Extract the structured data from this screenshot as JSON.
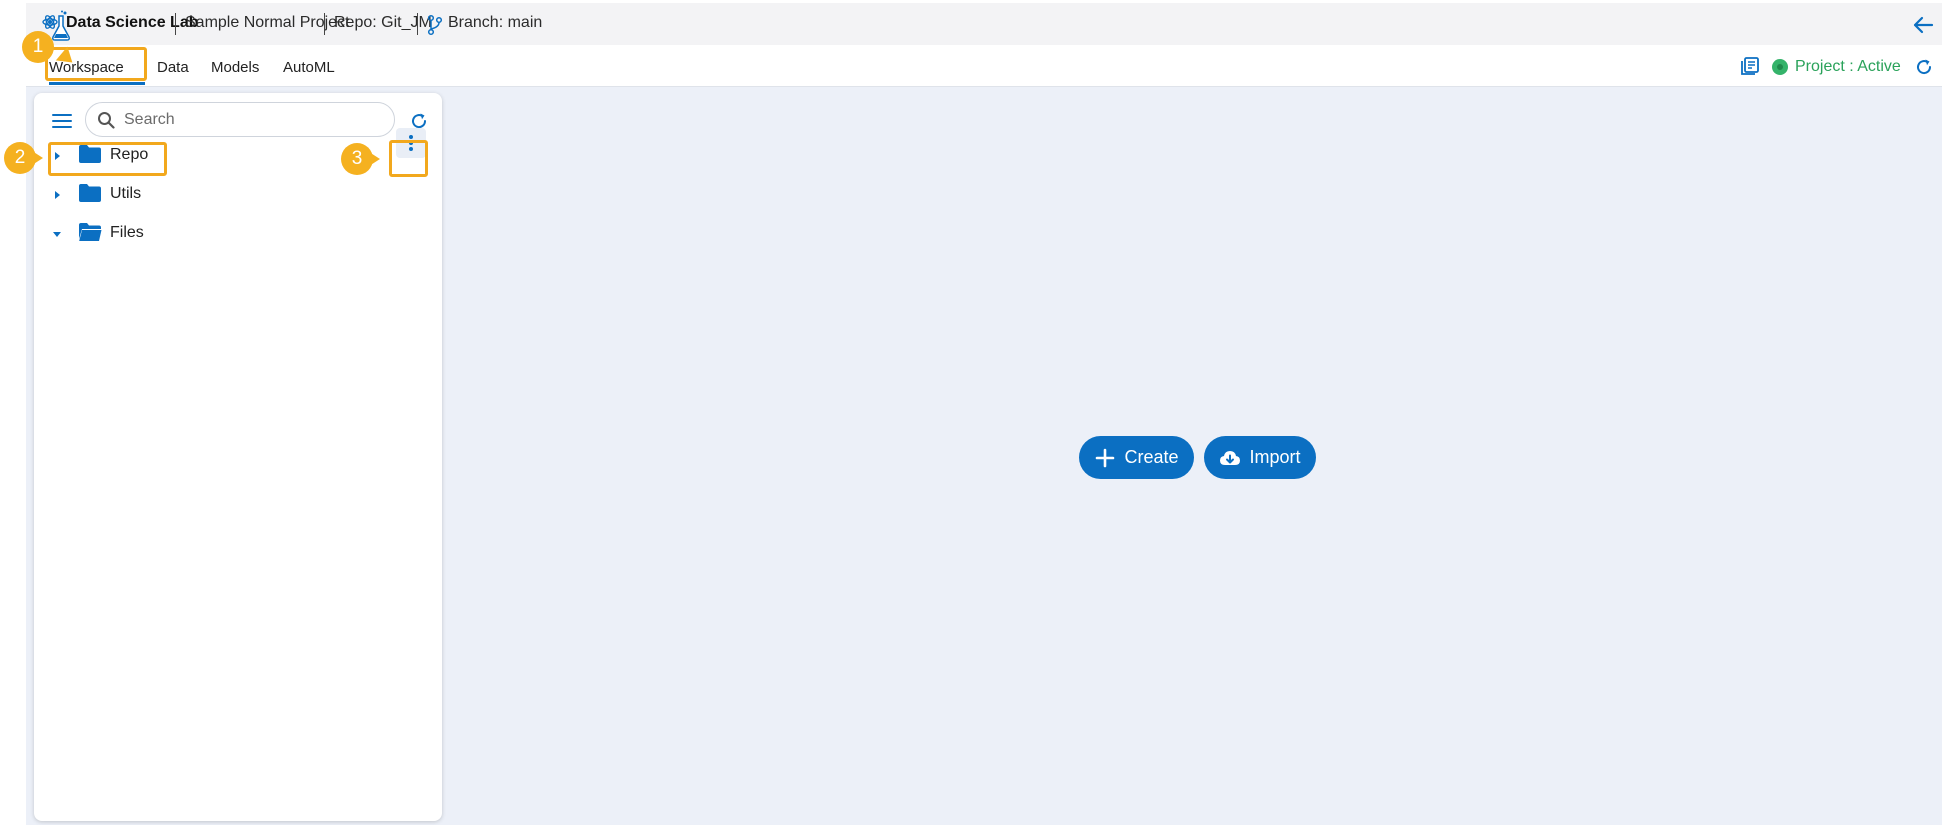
{
  "header": {
    "app_name": "Data Science Lab",
    "project_name": "Sample Normal Project",
    "repo": "Repo: Git_JM",
    "branch": "Branch: main"
  },
  "tabs": [
    {
      "label": "Workspace",
      "active": true
    },
    {
      "label": "Data",
      "active": false
    },
    {
      "label": "Models",
      "active": false
    },
    {
      "label": "AutoML",
      "active": false
    }
  ],
  "project_status": {
    "label": "Project : Active",
    "color": "#2aa25a"
  },
  "sidebar": {
    "search_placeholder": "Search",
    "tree": [
      {
        "label": "Repo",
        "expanded": false
      },
      {
        "label": "Utils",
        "expanded": false
      },
      {
        "label": "Files",
        "expanded": true
      }
    ]
  },
  "actions": {
    "create_label": "Create",
    "import_label": "Import"
  },
  "callouts": [
    "1",
    "2",
    "3"
  ],
  "colors": {
    "accent": "#0b6fc2",
    "highlight": "#f2a81d",
    "workspace_bg": "#ecf0f8"
  }
}
